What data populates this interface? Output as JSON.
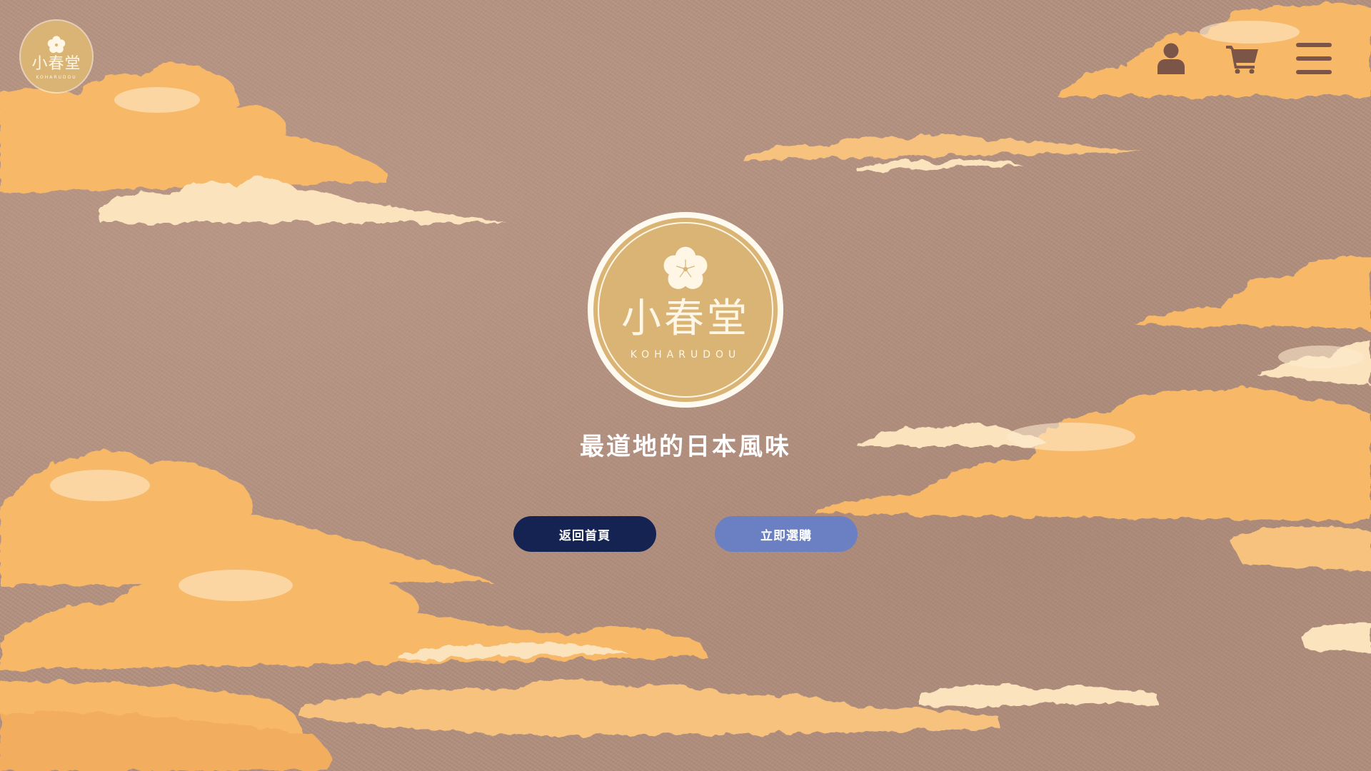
{
  "brand": {
    "name": "小春堂",
    "romanized": "KOHARUDOU"
  },
  "header": {
    "icons": [
      "user-icon",
      "cart-icon",
      "menu-icon"
    ]
  },
  "hero": {
    "tagline": "最道地的日本風味",
    "buttons": {
      "home_label": "返回首頁",
      "shop_label": "立即選購"
    }
  },
  "colors": {
    "background": "#b28f7e",
    "cloud": "#f7b868",
    "cloud_light": "#fbe6c4",
    "logo_gold": "#d9b474",
    "icon_dark": "#7a5548",
    "button_home": "#142352",
    "button_shop": "#6b80c3"
  }
}
